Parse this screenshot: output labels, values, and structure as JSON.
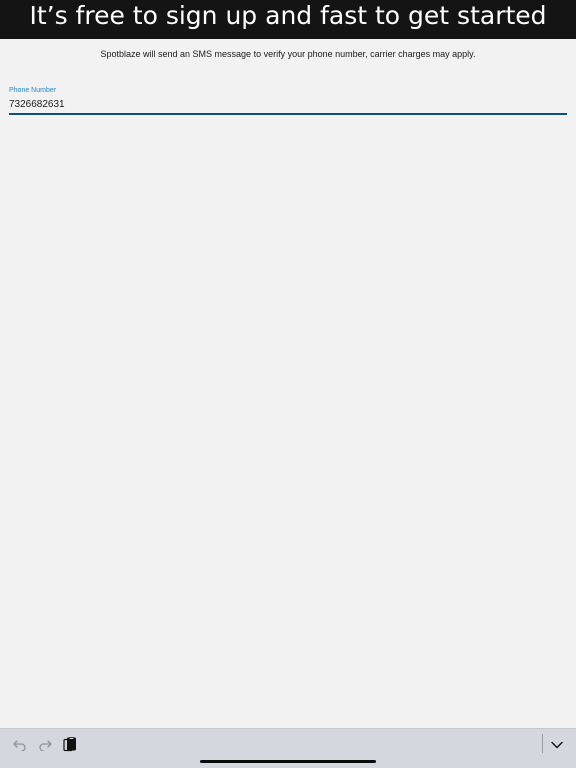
{
  "banner": {
    "text": "It’s free to sign up and fast to get started"
  },
  "info": {
    "text": "Spotblaze will send an SMS message to verify your phone number, carrier charges may apply."
  },
  "phone_field": {
    "label": "Phone Number",
    "value": "7326682631"
  },
  "colors": {
    "banner_bg": "#141414",
    "page_bg": "#f2f2f2",
    "field_label": "#1e88d8",
    "field_underline": "#0e4f80",
    "toolbar_bg": "#d4d7dd"
  },
  "keyboard_toolbar": {
    "icons": [
      "undo-icon",
      "redo-icon",
      "paste-icon",
      "chevron-down-icon"
    ]
  }
}
